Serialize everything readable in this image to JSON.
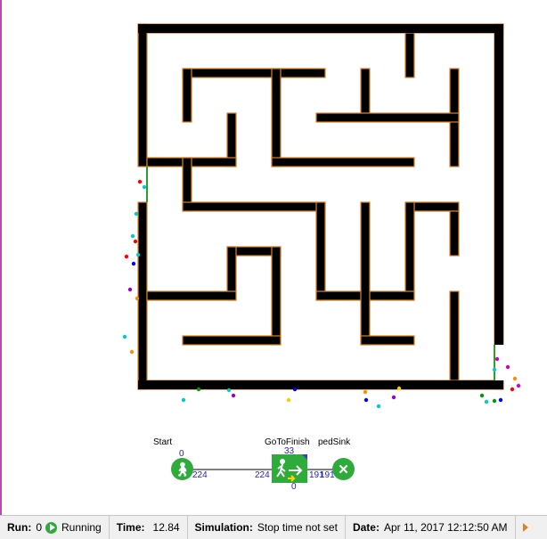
{
  "maze": {
    "wall_color": "#000000",
    "outline_color": "#d9822b",
    "entry_color": "#2ca02c"
  },
  "blocks": [
    {
      "id": "start",
      "label": "Start",
      "in_count": "0",
      "out_count": "224",
      "icon": "walking-person-icon"
    },
    {
      "id": "goto",
      "label": "GoToFinish",
      "top_count": "33",
      "in_count": "224",
      "out_count": "191",
      "bottom_count": "0",
      "icon": "exit-arrow-icon"
    },
    {
      "id": "sink",
      "label": "pedSink",
      "in_count": "191",
      "icon": "close-x-icon"
    }
  ],
  "status": {
    "run_label": "Run:",
    "run_value": "0",
    "state": "Running",
    "time_label": "Time:",
    "time_value": "12.84",
    "sim_label": "Simulation:",
    "sim_value": "Stop time not set",
    "date_label": "Date:",
    "date_value": "Apr 11, 2017 12:12:50 AM"
  },
  "colors": {
    "accent": "#2eab3a",
    "count": "#1c1cd0",
    "pedestrians": [
      "#ff0000",
      "#0000ff",
      "#00cccc",
      "#9900cc",
      "#ff8c00",
      "#cc00cc",
      "#009900",
      "#ffcc00"
    ]
  }
}
